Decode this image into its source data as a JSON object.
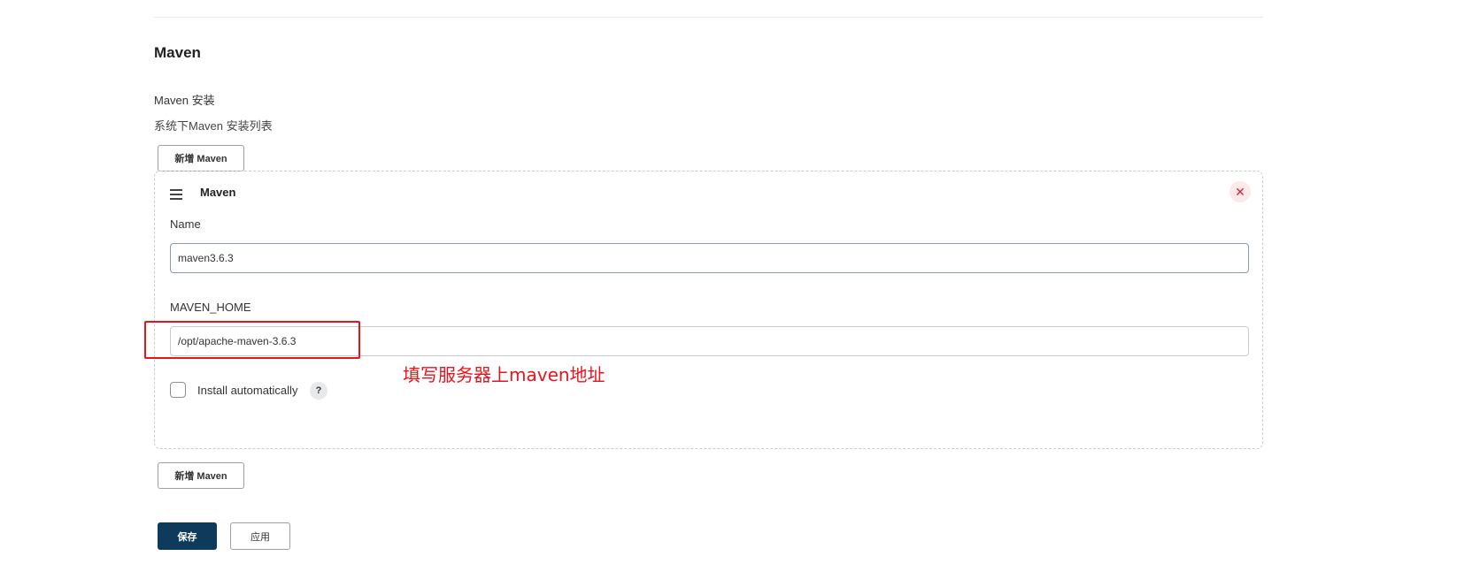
{
  "section": {
    "title": "Maven",
    "install_label": "Maven 安装",
    "install_desc": "系统下Maven 安装列表",
    "add_button_label": "新增 Maven"
  },
  "card": {
    "title": "Maven",
    "close_glyph": "✕",
    "name_label": "Name",
    "name_value": "maven3.6.3",
    "home_label": "MAVEN_HOME",
    "home_value": "/opt/apache-maven-3.6.3",
    "install_auto_label": "Install automatically",
    "install_auto_checked": false,
    "help_glyph": "?"
  },
  "annotation": {
    "text": "填写服务器上maven地址",
    "color": "#e8131b"
  },
  "footer": {
    "save_label": "保存",
    "apply_label": "应用"
  },
  "colors": {
    "save_button_bg": "#0e3a5c",
    "close_icon": "#d6243a"
  },
  "icons": {
    "drag": "drag-handle-icon",
    "close": "close-icon",
    "help": "help-icon"
  }
}
